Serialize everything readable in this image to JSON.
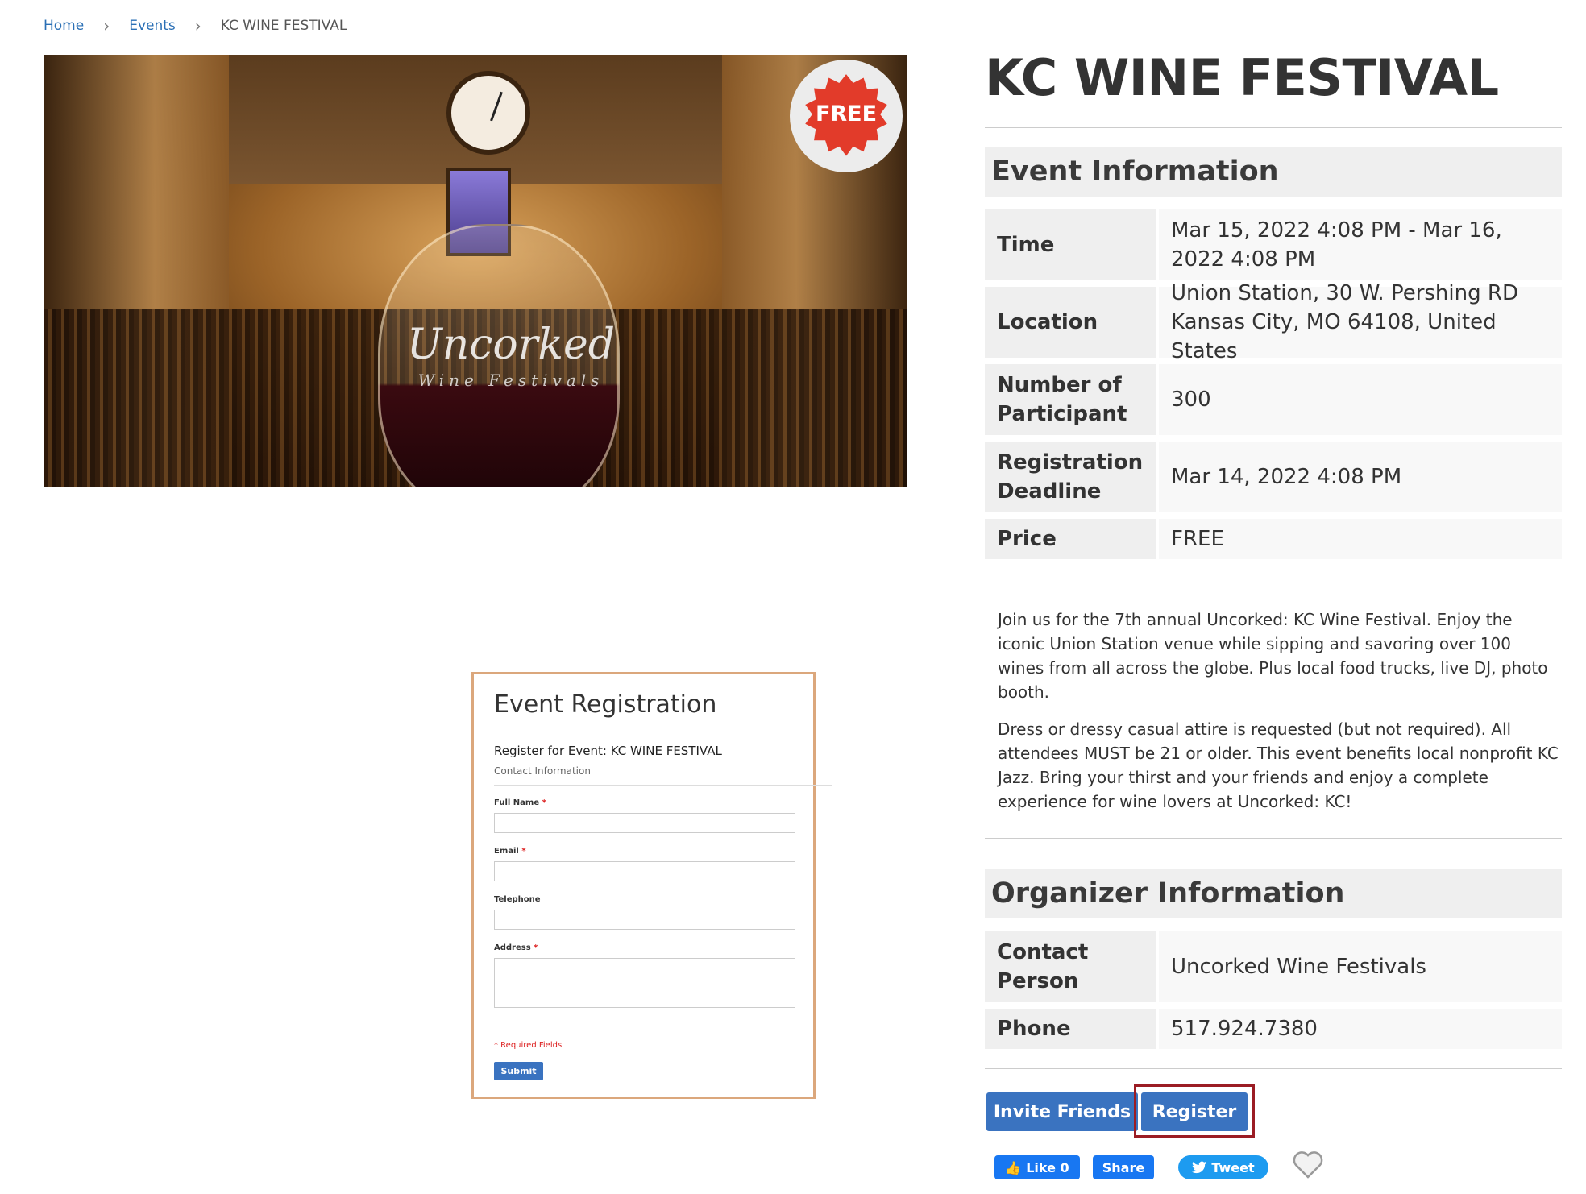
{
  "breadcrumb": {
    "home": "Home",
    "events": "Events",
    "current": "KC WINE FESTIVAL"
  },
  "hero": {
    "badge": "FREE",
    "logo_text": "Uncorked",
    "logo_sub": "Wine Festivals",
    "badge_color": "#e23b2a"
  },
  "event": {
    "title": "KC WINE FESTIVAL",
    "info_heading": "Event Information",
    "rows": [
      {
        "label": "Time",
        "value": "Mar 15, 2022 4:08 PM - Mar 16, 2022 4:08 PM"
      },
      {
        "label": "Location",
        "value": "Union Station, 30 W. Pershing RD Kansas City, MO 64108, United States"
      },
      {
        "label": "Number of Participant",
        "value": "300"
      },
      {
        "label": "Registration Deadline",
        "value": "Mar 14, 2022 4:08 PM"
      },
      {
        "label": "Price",
        "value": "FREE"
      }
    ],
    "description_1": "Join us for the 7th annual Uncorked: KC Wine Festival. Enjoy the iconic Union Station venue while sipping and savoring over 100 wines from all across the globe. Plus local food trucks, live DJ, photo booth.",
    "description_2": "Dress or dressy casual attire is requested (but not required). All attendees MUST be 21 or older. This event benefits local nonprofit KC Jazz. Bring your thirst and your friends and enjoy a complete experience for wine lovers at Uncorked: KC!"
  },
  "organizer": {
    "heading": "Organizer Information",
    "rows": [
      {
        "label": "Contact Person",
        "value": "Uncorked Wine Festivals"
      },
      {
        "label": "Phone",
        "value": "517.924.7380"
      }
    ]
  },
  "actions": {
    "invite": "Invite Friends",
    "register": "Register"
  },
  "social": {
    "like": "Like 0",
    "share": "Share",
    "tweet": "Tweet"
  },
  "registration_form": {
    "title": "Event Registration",
    "subtitle": "Register for Event: KC WINE FESTIVAL",
    "section": "Contact Information",
    "full_name": "Full Name",
    "email": "Email",
    "telephone": "Telephone",
    "address": "Address",
    "required_mark": "*",
    "required_note": "* Required Fields",
    "submit": "Submit"
  },
  "colors": {
    "accent": "#3a73c0",
    "link": "#2a6fb5",
    "highlight": "#9b1c24",
    "frame": "#dba77c"
  }
}
